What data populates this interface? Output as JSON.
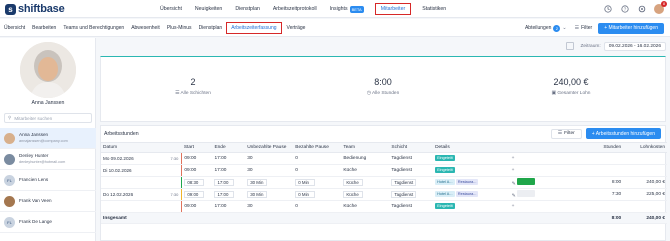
{
  "app": {
    "logo_text": "shiftbase",
    "logo_mark": "s",
    "notif_count": "8"
  },
  "nav": {
    "items": [
      {
        "label": "Übersicht"
      },
      {
        "label": "Neuigkeiten"
      },
      {
        "label": "Dienstplan"
      },
      {
        "label": "Arbeitszeitprotokoll"
      },
      {
        "label": "Insights",
        "badge": "BETA"
      },
      {
        "label": "Mitarbeiter",
        "active": true
      },
      {
        "label": "Statistiken"
      }
    ]
  },
  "subnav": {
    "items": [
      "Übersicht",
      "Bearbeiten",
      "Teams und Berechtigungen",
      "Abwesenheit",
      "Plus-Minus",
      "Dienstplan",
      "Arbeitszeiterfassung",
      "Verträge"
    ],
    "active": "Arbeitszeiterfassung",
    "abteilungen_label": "Abteilungen",
    "abteilungen_count": "2",
    "filter_label": "Filter",
    "add_employee_label": "+ Mitarbeiter hinzufügen"
  },
  "sidebar": {
    "employee_name": "Anna Janssen",
    "search_placeholder": "Mitarbeiter suchen",
    "employees": [
      {
        "name": "Anna Janssen",
        "email": "annajanssen@company.com",
        "initials": "AJ",
        "selected": true
      },
      {
        "name": "Denley Hunter",
        "email": "denleyhunter@hotmail.com",
        "initials": "DH",
        "selected": false
      },
      {
        "name": "Francien Lens",
        "email": "",
        "initials": "FL",
        "selected": false
      },
      {
        "name": "Frank Van Veen",
        "email": "",
        "initials": "FV",
        "selected": false
      },
      {
        "name": "Frank De Lange",
        "email": "",
        "initials": "FL",
        "selected": false
      }
    ]
  },
  "main": {
    "range_label": "Zeitraum:",
    "range_value": "09.02.2026 - 16.02.2026",
    "cards": [
      {
        "value": "2",
        "label": "Alle Schichten"
      },
      {
        "value": "8:00",
        "label": "Alle Stunden"
      },
      {
        "value": "240,00 €",
        "label": "Gesamter Lohn"
      }
    ]
  },
  "table": {
    "title": "Arbeitsstunden",
    "filter_label": "Filter",
    "add_label": "+ Arbeitsstunden hinzufügen",
    "headers": [
      "Datum",
      "Start",
      "Ende",
      "Unbezahlte Pause",
      "Bezahlte Pause",
      "Team",
      "Schicht",
      "Details",
      "",
      "Stunden",
      "Lohnkosten"
    ],
    "rows": [
      {
        "date": "Mo 09.02.2026",
        "dur": "7:30",
        "start": "09:00",
        "end": "17:00",
        "up": "30",
        "bp": "0",
        "team": "Bedienung",
        "shift": "Tagdienst",
        "tag": "Eingeteilt",
        "hours": "",
        "cost": ""
      },
      {
        "date": "Di 10.02.2026",
        "dur": "",
        "start": "09:00",
        "end": "17:00",
        "up": "30",
        "bp": "0",
        "team": "Küche",
        "shift": "Tagdienst",
        "tag": "Eingeteilt",
        "hours": "",
        "cost": ""
      },
      {
        "date": "",
        "dur": "",
        "start": "08:30",
        "end": "17:00",
        "up": "30 Min",
        "bp": "0 Min",
        "team": "Küche",
        "shift": "Tagdienst",
        "chips": [
          "Hotel A...",
          "Restaura..."
        ],
        "hours": "8:00",
        "cost": "240,00 €"
      },
      {
        "date": "Do 12.02.2026",
        "dur": "7:30",
        "start": "09:00",
        "end": "17:00",
        "up": "30 Min",
        "bp": "0 Min",
        "team": "Küche",
        "shift": "Tagdienst",
        "chips": [
          "Hotel A...",
          "Restaura..."
        ],
        "hours": "7:30",
        "cost": "225,00 €"
      },
      {
        "date": "",
        "dur": "",
        "start": "09:00",
        "end": "17:00",
        "up": "30",
        "bp": "0",
        "team": "Küche",
        "shift": "Tagdienst",
        "tag": "Eingeteilt",
        "hours": "",
        "cost": ""
      }
    ],
    "total_label": "Insgesamt",
    "total_hours": "8:00",
    "total_cost": "240,00 €"
  }
}
